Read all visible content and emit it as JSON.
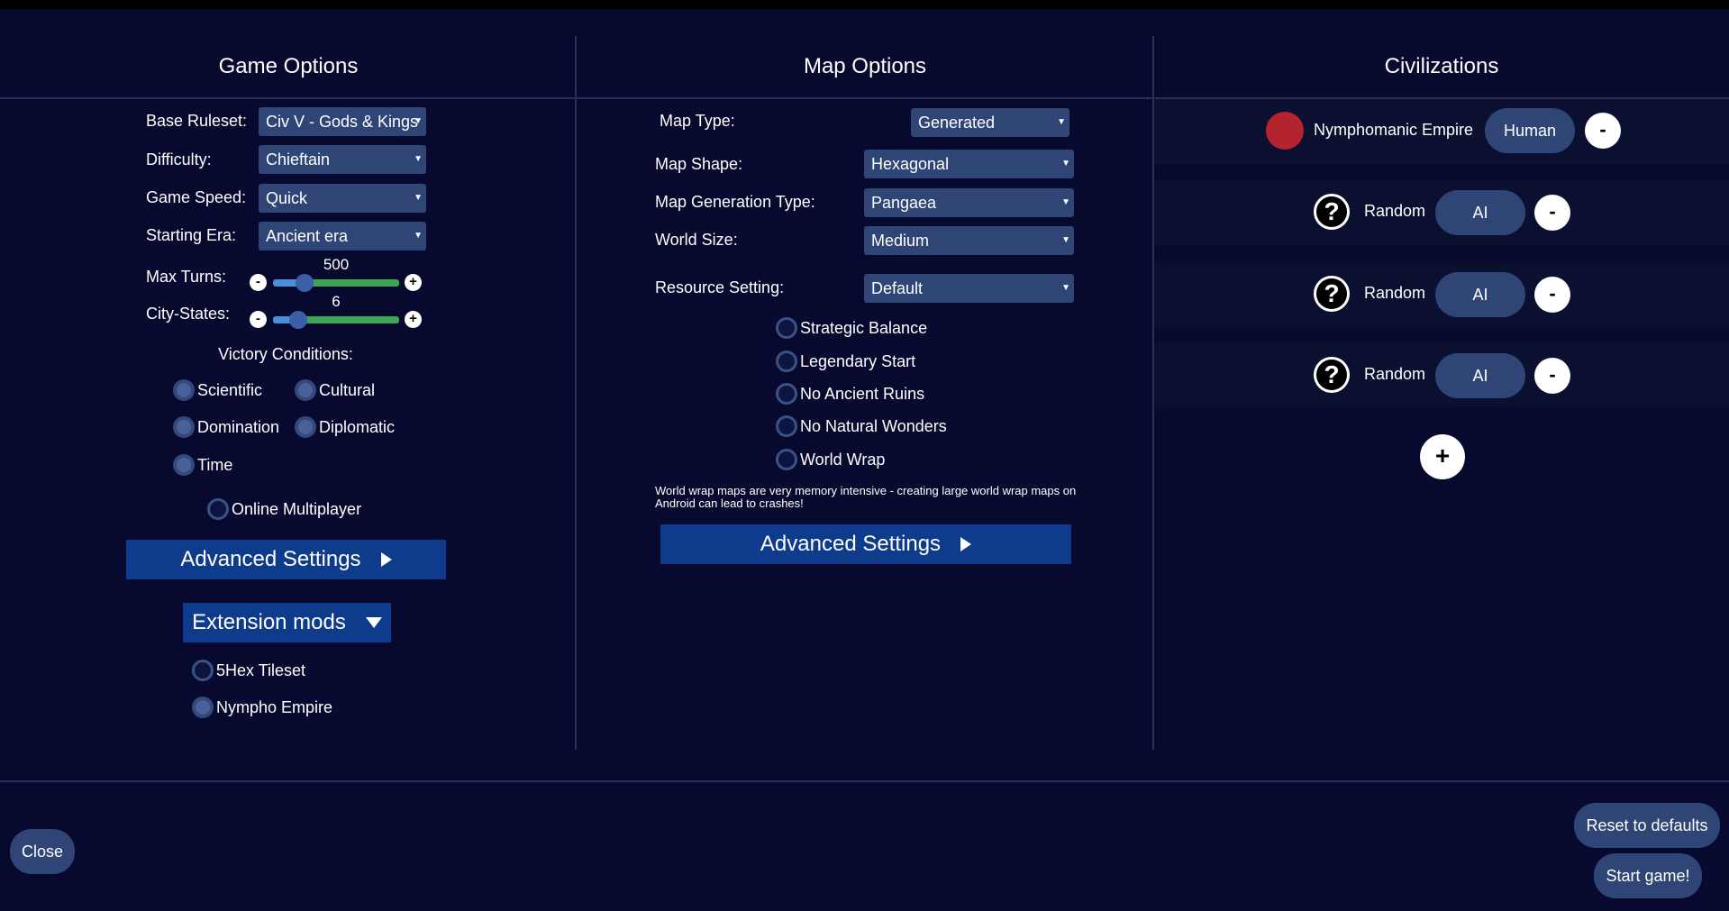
{
  "colors": {
    "background": "#070a2e",
    "select": "#2e4576",
    "button": "#0e3b8c",
    "slider_fill": "#4a90d9",
    "slider_rest": "#3aa655",
    "civ_icon": "#b3242e"
  },
  "columns": {
    "game_title": "Game Options",
    "map_title": "Map Options",
    "civ_title": "Civilizations"
  },
  "game": {
    "ruleset_label": "Base Ruleset:",
    "ruleset_value": "Civ V - Gods & Kings",
    "difficulty_label": "Difficulty:",
    "difficulty_value": "Chieftain",
    "speed_label": "Game Speed:",
    "speed_value": "Quick",
    "era_label": "Starting Era:",
    "era_value": "Ancient era",
    "max_turns_label": "Max Turns:",
    "max_turns_value": "500",
    "max_turns_fraction": 0.25,
    "city_states_label": "City-States:",
    "city_states_value": "6",
    "city_states_fraction": 0.2,
    "victory_label": "Victory Conditions:",
    "victories": [
      "Scientific",
      "Cultural",
      "Domination",
      "Diplomatic",
      "Time"
    ],
    "online_multiplayer": "Online Multiplayer",
    "advanced": "Advanced Settings",
    "extension_mods": "Extension mods",
    "mods": [
      "5Hex Tileset",
      "Nympho Empire"
    ]
  },
  "map": {
    "type_label": "Map Type:",
    "type_value": "Generated",
    "shape_label": "Map Shape:",
    "shape_value": "Hexagonal",
    "gen_label": "Map Generation Type:",
    "gen_value": "Pangaea",
    "size_label": "World Size:",
    "size_value": "Medium",
    "resource_label": "Resource Setting:",
    "resource_value": "Default",
    "checks": [
      "Strategic Balance",
      "Legendary Start",
      "No Ancient Ruins",
      "No Natural Wonders",
      "World Wrap"
    ],
    "note": "World wrap maps are very memory intensive - creating large world wrap maps on Android can lead to crashes!",
    "advanced": "Advanced Settings"
  },
  "civs": {
    "player_name": "Nymphomanic Empire",
    "player_type": "Human",
    "random_label": "Random",
    "ai_label": "AI",
    "remove": "-",
    "add": "+"
  },
  "bottom": {
    "close": "Close",
    "reset": "Reset to defaults",
    "start": "Start game!"
  }
}
